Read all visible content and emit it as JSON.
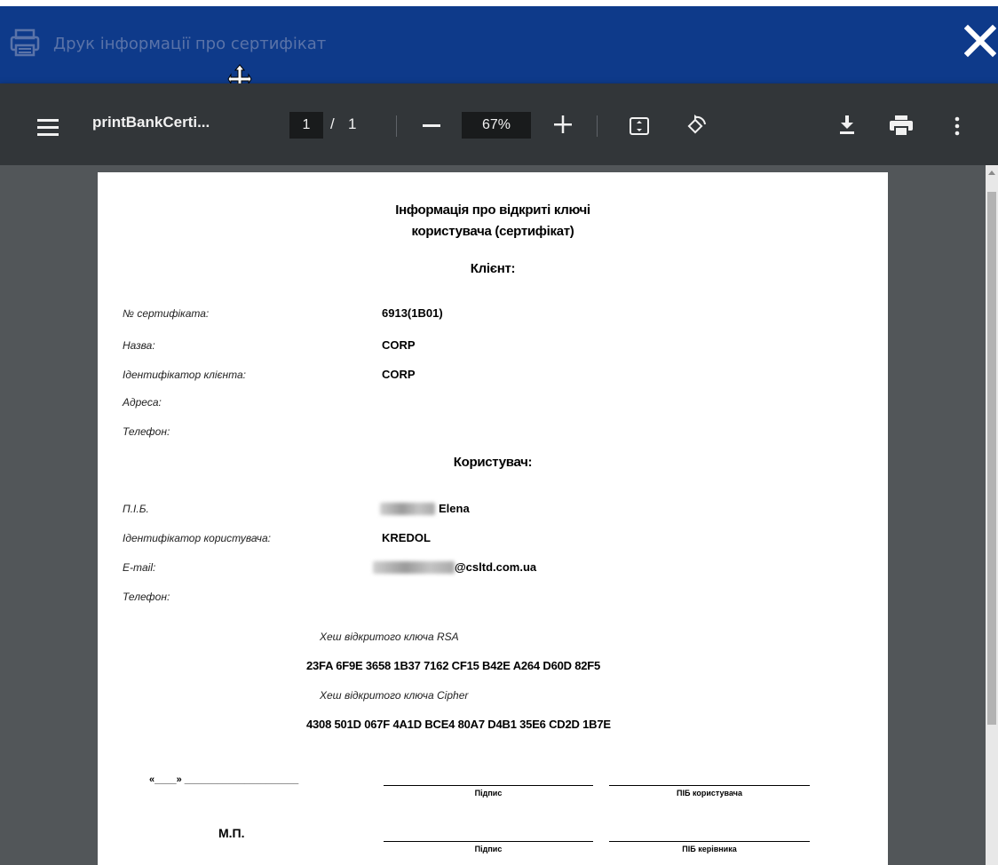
{
  "window": {
    "title": "Друк інформації про сертифікат",
    "close_label": "✕",
    "icons": [
      "printer-icon",
      "move-cursor-icon",
      "close-icon"
    ]
  },
  "pdf_toolbar": {
    "file_name": "printBankCerti...",
    "current_page": "1",
    "page_separator": "/",
    "total_pages": "1",
    "zoom": "67%",
    "icons": [
      "menu-icon",
      "zoom-out-icon",
      "zoom-in-icon",
      "fit-page-icon",
      "rotate-icon",
      "download-icon",
      "print-icon",
      "more-icon"
    ]
  },
  "document": {
    "heading_line1": "Інформація про відкриті ключі",
    "heading_line2": "користувача (сертифікат)",
    "client_heading": "Клієнт:",
    "client_fields": [
      {
        "label": "№ сертифіката:",
        "value": "6913(1B01)"
      },
      {
        "label": "Назва:",
        "value": "CORP"
      },
      {
        "label": "Ідентифікатор клієнта:",
        "value": "CORP"
      },
      {
        "label": "Адреса:",
        "value": ""
      },
      {
        "label": "Телефон:",
        "value": ""
      }
    ],
    "user_heading": "Користувач:",
    "user_fields": [
      {
        "label": "П.І.Б.",
        "value": "Elena"
      },
      {
        "label": "Ідентифікатор користувача:",
        "value": "KREDOL"
      },
      {
        "label": "E-mail:",
        "value": "@csltd.com.ua"
      },
      {
        "label": "Телефон:",
        "value": ""
      }
    ],
    "rsa_hash_label": "Хеш відкритого ключа RSA",
    "rsa_hash_value": "23FA 6F9E 3658 1B37 7162 CF15 B42E A264 D60D 82F5",
    "cipher_hash_label": "Хеш відкритого ключа Cipher",
    "cipher_hash_value": "4308 501D 067F 4A1D BCE4 80A7 D4B1 35E6 CD2D 1B7E",
    "date_placeholder": "«____» _____________________",
    "signature_caption": "Підпис",
    "user_name_caption": "ПІБ користувача",
    "stamp_label": "М.П.",
    "signature_caption_2": "Підпис",
    "manager_name_caption": "ПІБ керівника"
  },
  "colors": {
    "title_bar": "#0e3a8a",
    "toolbar": "#323639",
    "viewer_bg": "#525659",
    "page": "#ffffff"
  }
}
